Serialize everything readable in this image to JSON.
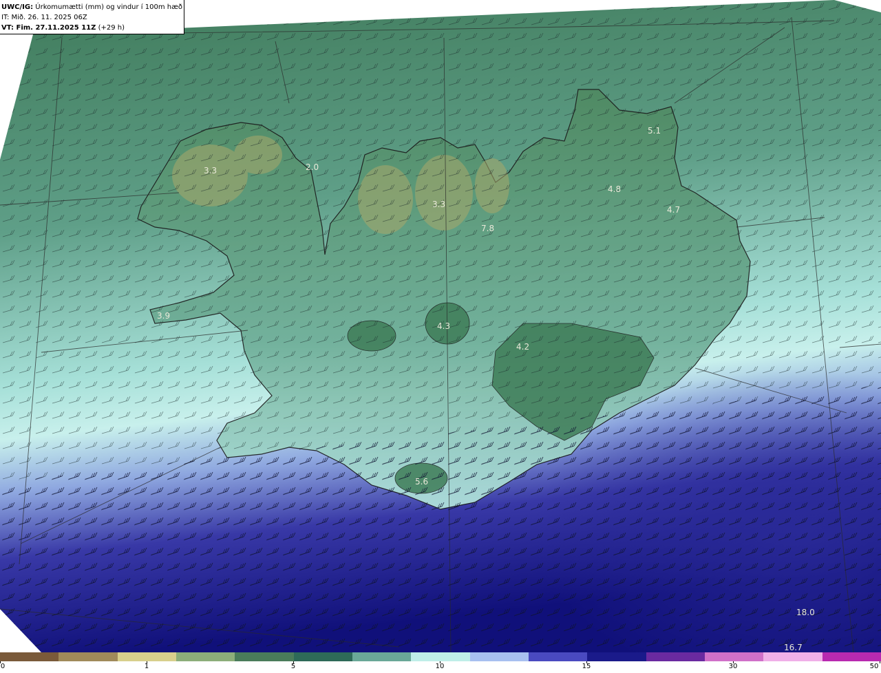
{
  "header": {
    "model": "UWC/IG:",
    "title": "Úrkomumætti (mm) og vindur í 100m hæð",
    "init_time": "IT: Mið. 26. 11. 2025 06Z",
    "valid_label": "VT: Fim. 27.11.2025 11Z",
    "lead": "(+29 h)"
  },
  "map": {
    "value_labels": [
      {
        "text": "3.3",
        "name": "label-westfjords"
      },
      {
        "text": "2.0",
        "name": "label-strandir"
      },
      {
        "text": "3.3",
        "name": "label-trollaskagi"
      },
      {
        "text": "7.8",
        "name": "label-eyjafjordur"
      },
      {
        "text": "5.1",
        "name": "label-northeast"
      },
      {
        "text": "4.8",
        "name": "label-east-highlands"
      },
      {
        "text": "4.7",
        "name": "label-east"
      },
      {
        "text": "3.9",
        "name": "label-snaefellsnes"
      },
      {
        "text": "4.3",
        "name": "label-hofsjokull"
      },
      {
        "text": "4.2",
        "name": "label-vatnajokull"
      },
      {
        "text": "5.6",
        "name": "label-myrdalsjokull"
      },
      {
        "text": "18.0",
        "name": "label-south-sea"
      },
      {
        "text": "16.7",
        "name": "label-south-sea-2"
      }
    ],
    "palette": {
      "dry_green": "#4a7a52",
      "teal": "#6aa898",
      "light_cyan": "#c6eee8",
      "blue": "#3a3aa8",
      "navy": "#12127a",
      "upland": "#a9a86a"
    }
  },
  "colorbar": {
    "ticks": [
      "0",
      "1",
      "5",
      "10",
      "15",
      "30",
      "50"
    ],
    "colors": [
      "#7a5a3a",
      "#a08a5a",
      "#d8cf8c",
      "#8cae7a",
      "#4a7c5a",
      "#2e6a58",
      "#6aa898",
      "#bfeee8",
      "#a8c0f0",
      "#4a4ac0",
      "#1a1a8a",
      "#6a2aa0",
      "#d070c8",
      "#f0b0e8",
      "#b82ab0"
    ]
  }
}
